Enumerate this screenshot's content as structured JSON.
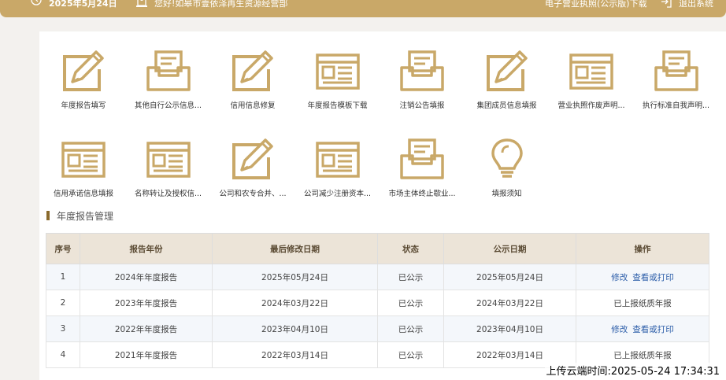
{
  "topbar": {
    "date": "2025年5月24日",
    "greeting": "您好!如皋市壹依泽再生资源经营部",
    "license_download": "电子营业执照(公示版)下载",
    "logout": "退出系统",
    "colors": {
      "bar": "#c9a868"
    }
  },
  "tiles": [
    {
      "label": "年度报告填写",
      "icon": "pencil-form-icon"
    },
    {
      "label": "其他自行公示信息...",
      "icon": "inbox-tray-icon"
    },
    {
      "label": "信用信息修复",
      "icon": "pencil-form-icon"
    },
    {
      "label": "年度报告模板下载",
      "icon": "browser-window-icon"
    },
    {
      "label": "注销公告填报",
      "icon": "inbox-tray-icon"
    },
    {
      "label": "集团成员信息填报",
      "icon": "pencil-form-icon"
    },
    {
      "label": "营业执照作废声明...",
      "icon": "browser-window-icon"
    },
    {
      "label": "执行标准自我声明...",
      "icon": "inbox-tray-icon"
    },
    {
      "label": "信用承诺信息填报",
      "icon": "browser-window-icon"
    },
    {
      "label": "名称转让及授权信...",
      "icon": "browser-window-icon"
    },
    {
      "label": "公司和农专合并、...",
      "icon": "pencil-form-icon"
    },
    {
      "label": "公司减少注册资本...",
      "icon": "browser-window-icon"
    },
    {
      "label": "市场主体终止歇业...",
      "icon": "inbox-tray-icon"
    },
    {
      "label": "填报须知",
      "icon": "lightbulb-icon"
    }
  ],
  "section": {
    "title": "年度报告管理"
  },
  "table": {
    "headers": [
      "序号",
      "报告年份",
      "最后修改日期",
      "状态",
      "公示日期",
      "操作"
    ],
    "rows": [
      {
        "no": "1",
        "year": "2024年年度报告",
        "modified": "2025年05月24日",
        "status": "已公示",
        "published": "2025年05月24日",
        "op1": "修改",
        "op2": "查看或打印",
        "note": ""
      },
      {
        "no": "2",
        "year": "2023年年度报告",
        "modified": "2024年03月22日",
        "status": "已公示",
        "published": "2024年03月22日",
        "op1": "",
        "op2": "",
        "note": "已上报纸质年报"
      },
      {
        "no": "3",
        "year": "2022年年度报告",
        "modified": "2023年04月10日",
        "status": "已公示",
        "published": "2023年04月10日",
        "op1": "修改",
        "op2": "查看或打印",
        "note": ""
      },
      {
        "no": "4",
        "year": "2021年年度报告",
        "modified": "2022年03月14日",
        "status": "已公示",
        "published": "2022年03月14日",
        "op1": "",
        "op2": "",
        "note": "已上报纸质年报"
      }
    ]
  },
  "watermark": "上传云端时间:2025-05-24 17:34:31",
  "colors": {
    "gold": "#c9a868",
    "link": "#2a5ca8",
    "header_bg": "#ece4d8"
  }
}
